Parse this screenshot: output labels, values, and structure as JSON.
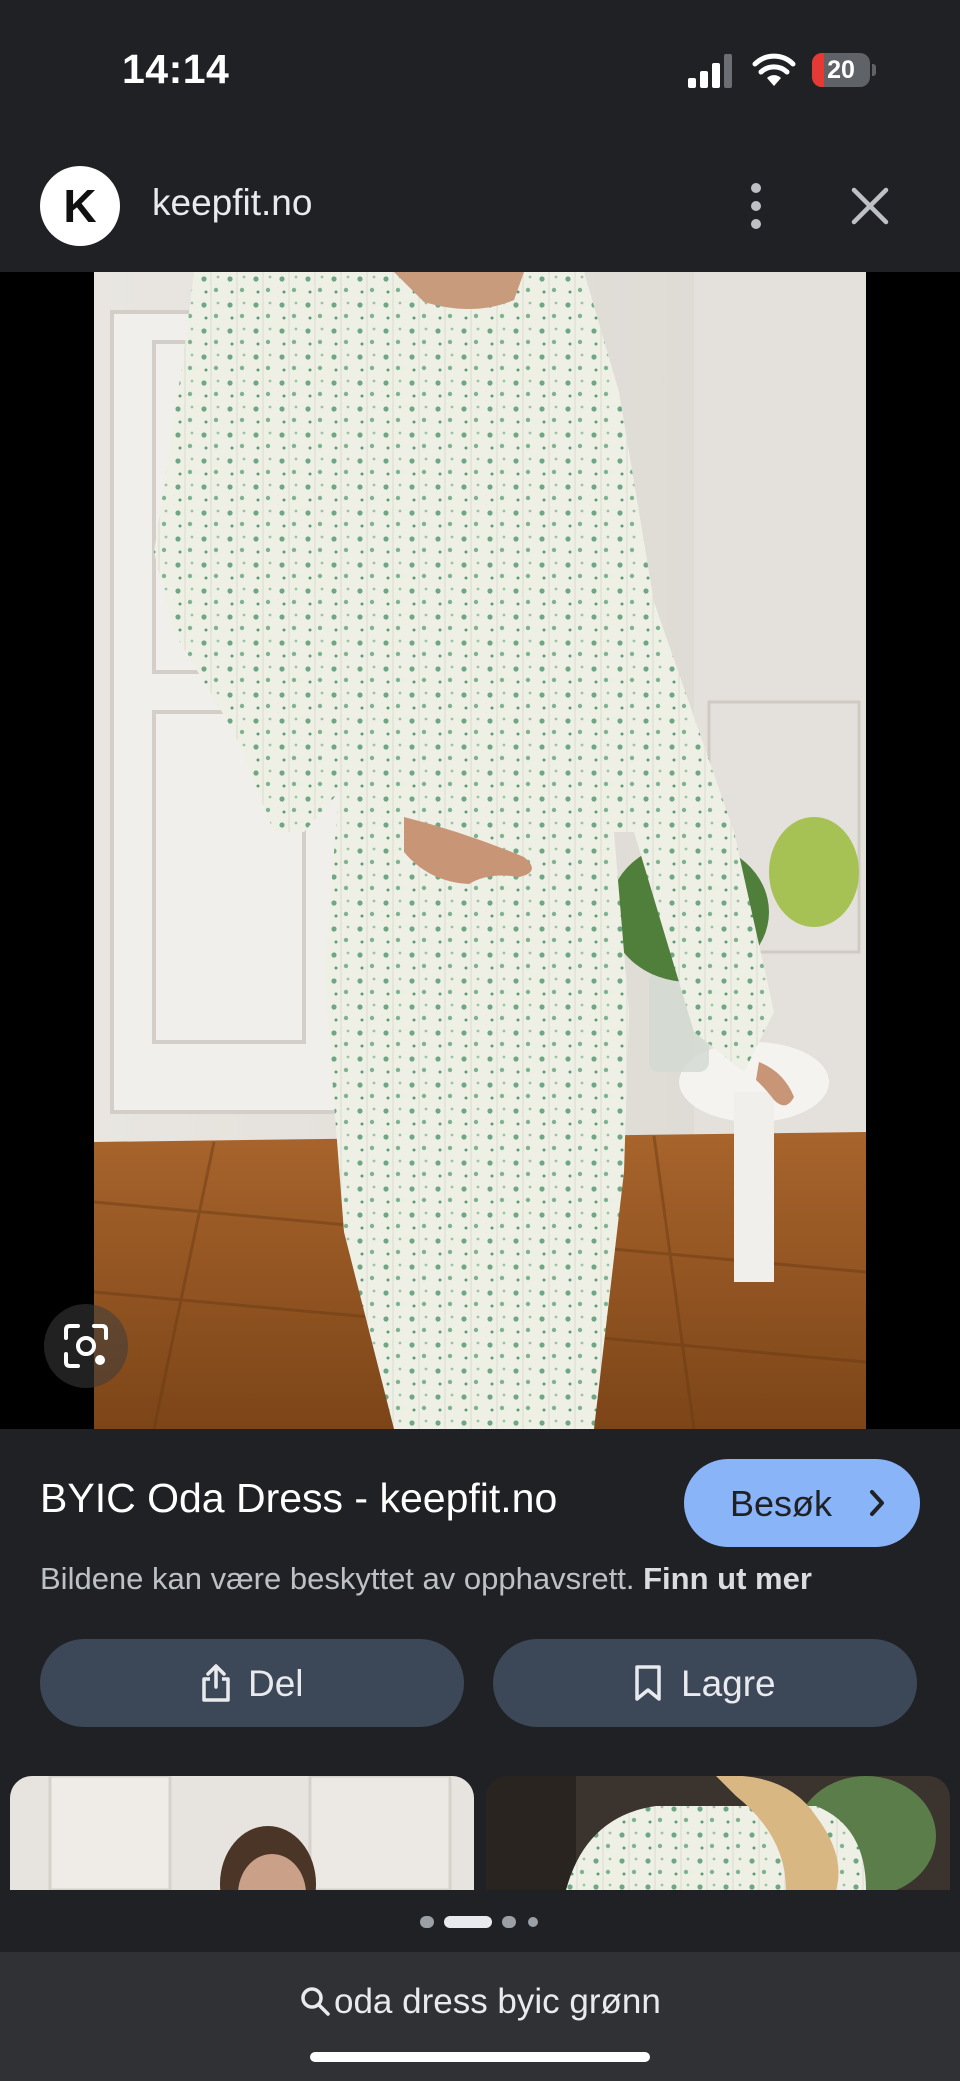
{
  "status_bar": {
    "time": "14:14",
    "battery": "20",
    "battery_level": 0.2
  },
  "header": {
    "logo_letter": "K",
    "site": "keepfit.no"
  },
  "result": {
    "title": "BYIC Oda Dress - keepfit.no",
    "visit_label": "Besøk",
    "copyright_text": "Bildene kan være beskyttet av opphavsrett.",
    "copyright_link": "Finn ut mer"
  },
  "actions": {
    "share_label": "Del",
    "save_label": "Lagre"
  },
  "pager": {
    "active_index": 1,
    "count": 4
  },
  "search": {
    "query": "oda dress byic grønn"
  },
  "icons": [
    "signal-icon",
    "wifi-icon",
    "battery-icon",
    "more-vert-icon",
    "close-icon",
    "lens-icon",
    "chevron-right-icon",
    "share-icon",
    "bookmark-icon",
    "search-icon"
  ],
  "colors": {
    "background": "#202124",
    "accent": "#8ab4f8",
    "button": "#3c4758",
    "battery_low": "#e53935"
  }
}
